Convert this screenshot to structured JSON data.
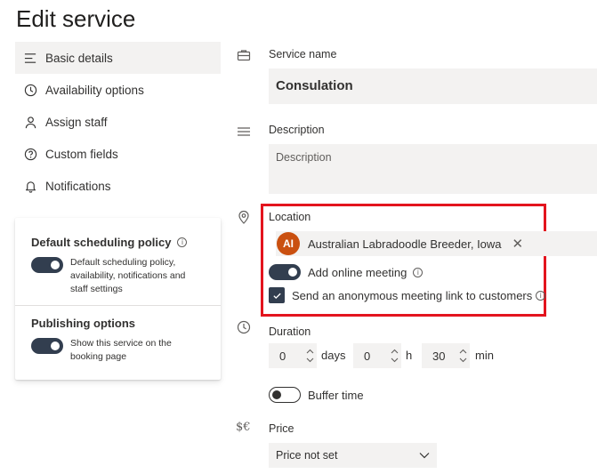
{
  "page": {
    "title": "Edit service"
  },
  "nav": {
    "items": [
      {
        "label": "Basic details",
        "icon": "menu-lines-icon",
        "active": true
      },
      {
        "label": "Availability options",
        "icon": "clock-icon"
      },
      {
        "label": "Assign staff",
        "icon": "person-icon"
      },
      {
        "label": "Custom fields",
        "icon": "question-circle-icon"
      },
      {
        "label": "Notifications",
        "icon": "bell-icon"
      }
    ]
  },
  "policy_card": {
    "default_policy": {
      "title": "Default scheduling policy",
      "description": "Default scheduling policy, availability, notifications and staff settings",
      "enabled": true
    },
    "publishing": {
      "title": "Publishing options",
      "description": "Show this service on the booking page",
      "enabled": true
    }
  },
  "form": {
    "service_name": {
      "label": "Service name",
      "value": "Consulation"
    },
    "description": {
      "label": "Description",
      "placeholder": "Description"
    },
    "location": {
      "label": "Location",
      "chip_initials": "AI",
      "chip_color": "#ca5010",
      "chip_text": "Australian Labradoodle Breeder, Iowa",
      "online_meeting_label": "Add online meeting",
      "online_meeting_enabled": true,
      "anonymous_link_label": "Send an anonymous meeting link to customers",
      "anonymous_link_checked": true
    },
    "duration": {
      "label": "Duration",
      "days": "0",
      "days_unit": "days",
      "hours": "0",
      "hours_unit": "h",
      "minutes": "30",
      "minutes_unit": "min"
    },
    "buffer_time": {
      "label": "Buffer time",
      "enabled": false
    },
    "price": {
      "label": "Price",
      "selected": "Price not set",
      "icon_text": "$€"
    }
  },
  "colors": {
    "accent": "#323e4f",
    "highlight_border": "#e3141e",
    "field_bg": "#f3f2f1"
  }
}
